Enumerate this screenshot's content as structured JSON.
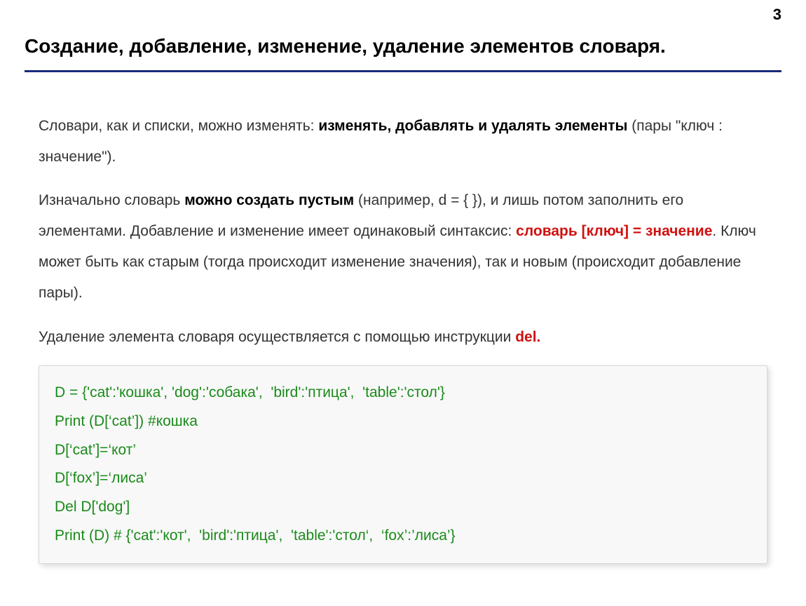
{
  "page_number": "3",
  "title": "Создание, добавление, изменение, удаление элементов словаря.",
  "para1": {
    "t1": "Словари, как и списки, можно изменять: ",
    "bold": "изменять, добавлять и  удалять элементы",
    "t2": " (пары \"ключ :   значение\")."
  },
  "para2": {
    "t1": "Изначально словарь ",
    "bold1": "можно создать пустым",
    "t2": " (например, d = { }), и лишь потом заполнить его элементами.  Добавление и изменение имеет одинаковый синтаксис: ",
    "red": "словарь [ключ] = значение",
    "t3": ". Ключ может быть как старым (тогда происходит изменение значения), так и новым (происходит добавление пары)."
  },
  "para3": {
    "t1": "Удаление элемента словаря осуществляется с помощью инструкции ",
    "red": "del.",
    "t2": ""
  },
  "code": {
    "l1": "D = {'cat':'кошка', 'dog':'собака',  'bird':'птица',  'table':'стол'}",
    "l2": "Print (D[‘cat’]) #кошка",
    "l3": "D[‘cat’]=‘кот’",
    "l4": "D[‘fox’]=‘лиса’",
    "l5": "Del D['dog']",
    "l6": "Print (D) # {'cat':'кот',  'bird':'птица',  'table':'стол‘,  ‘fox’:’лиса’}"
  }
}
